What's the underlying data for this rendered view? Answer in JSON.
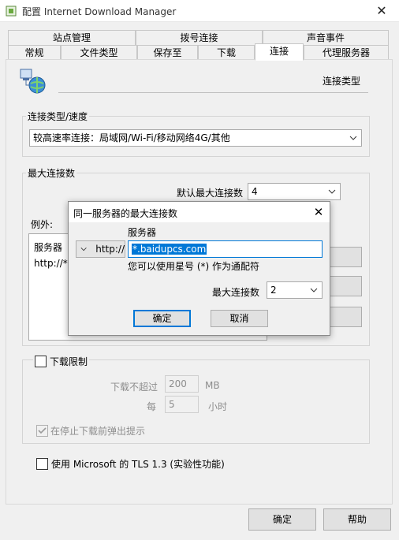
{
  "window": {
    "title": "配置 Internet Download Manager",
    "close_symbol": "✕"
  },
  "tabs_row1": [
    "站点管理",
    "拨号连接",
    "声音事件"
  ],
  "tabs_row2": [
    "常规",
    "文件类型",
    "保存至",
    "下载",
    "连接",
    "代理服务器"
  ],
  "active_tab": "连接",
  "header": {
    "section_title": "连接类型"
  },
  "connection_group": {
    "label": "连接类型/速度",
    "selected": "较高速率连接：局域网/Wi-Fi/移动网络4G/其他"
  },
  "max_conn_group": {
    "label": "最大连接数",
    "default_label": "默认最大连接数",
    "default_value": "4",
    "exceptions_label": "例外:",
    "list_header": "服务器",
    "list_item": "http://*",
    "buttons": [
      "新建",
      "删除",
      "编辑"
    ]
  },
  "download_limit": {
    "checkbox_label": "下载限制",
    "limit_label": "下载不超过",
    "limit_value": "200",
    "limit_unit": "MB",
    "every_label": "每",
    "every_value": "5",
    "every_unit": "小时",
    "prompt_label": "在停止下载前弹出提示"
  },
  "tls": {
    "checkbox_label": "使用 Microsoft 的 TLS 1.3 (实验性功能)"
  },
  "footer": {
    "ok": "确定",
    "help": "帮助"
  },
  "dialog": {
    "title": "同一服务器的最大连接数",
    "close_symbol": "✕",
    "protocol": "http://",
    "server_label": "服务器",
    "server_value": "*.baidupcs.com",
    "hint": "您可以使用星号 (*) 作为通配符",
    "max_label": "最大连接数",
    "max_value": "2",
    "ok": "确定",
    "cancel": "取消"
  }
}
